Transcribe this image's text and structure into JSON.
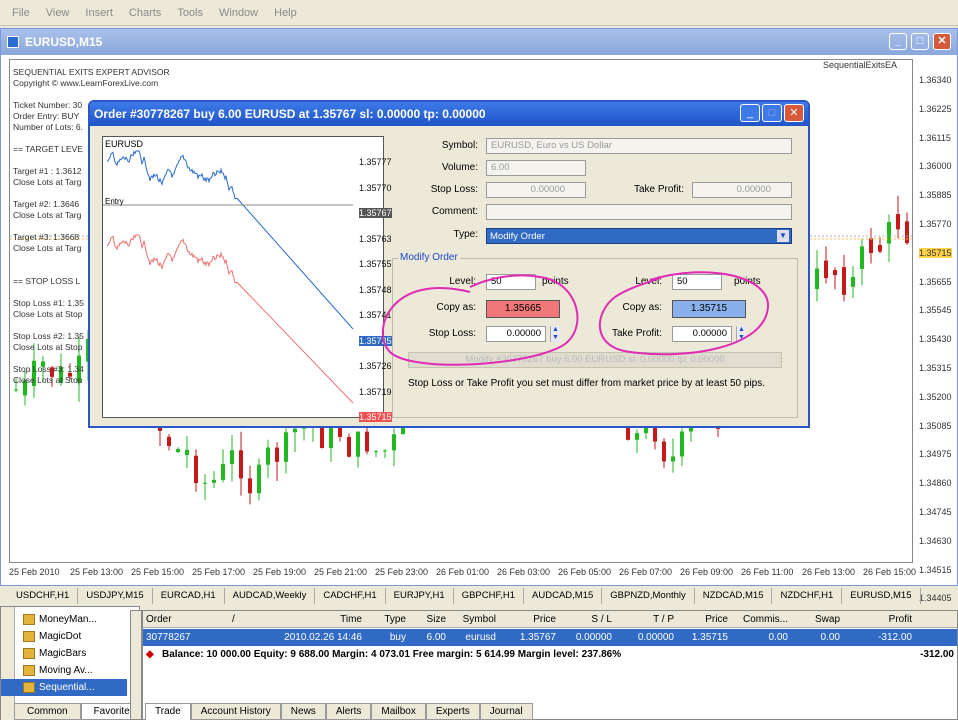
{
  "menu": [
    "File",
    "View",
    "Insert",
    "Charts",
    "Tools",
    "Window",
    "Help"
  ],
  "chart_window": {
    "title": "EURUSD,M15",
    "ea_label": "SequentialExitsEA",
    "y_ticks": [
      "1.36340",
      "1.36225",
      "1.36115",
      "1.36000",
      "1.35885",
      "1.35770",
      "1.35715",
      "1.35655",
      "1.35545",
      "1.35430",
      "1.35315",
      "1.35200",
      "1.35085",
      "1.34975",
      "1.34860",
      "1.34745",
      "1.34630",
      "1.34515",
      "1.34405"
    ],
    "x_ticks": [
      "25 Feb 2010",
      "25 Feb 13:00",
      "25 Feb 15:00",
      "25 Feb 17:00",
      "25 Feb 19:00",
      "25 Feb 21:00",
      "25 Feb 23:00",
      "26 Feb 01:00",
      "26 Feb 03:00",
      "26 Feb 05:00",
      "26 Feb 07:00",
      "26 Feb 09:00",
      "26 Feb 11:00",
      "26 Feb 13:00",
      "26 Feb 15:00"
    ],
    "info_lines": [
      "SEQUENTIAL EXITS EXPERT ADVISOR",
      "Copyright © www.LearnForexLive.com",
      "",
      "Ticket Number: 30",
      "Order Entry: BUY",
      "Number of Lots: 6.",
      "",
      "== TARGET LEVE",
      "",
      "Target #1 : 1.3612",
      "Close Lots at Targ",
      "",
      "Target #2: 1.3646",
      "Close Lots at Targ",
      "",
      "Target #3: 1.3668",
      "Close Lots at Targ",
      "",
      "",
      "== STOP LOSS L",
      "",
      "Stop Loss #1: 1.35",
      "Close Lots at Stop",
      "",
      "Stop Loss #2: 1.35",
      "Close Lots at Stop",
      "",
      "Stop Loss #3: 1.34",
      "Close Lots at Stop"
    ]
  },
  "symbol_tabs": [
    "USDCHF,H1",
    "USDJPY,M15",
    "EURCAD,H1",
    "AUDCAD,Weekly",
    "CADCHF,H1",
    "EURJPY,H1",
    "GBPCHF,H1",
    "AUDCAD,M15",
    "GBPNZD,Monthly",
    "NZDCAD,M15",
    "NZDCHF,H1",
    "EURUSD,M15"
  ],
  "navigator": {
    "items": [
      "MoneyMan...",
      "MagicDot",
      "MagicBars",
      "Moving Av...",
      "Sequential..."
    ],
    "tabs": [
      "Common",
      "Favorite"
    ],
    "side_label": "Navigator"
  },
  "terminal": {
    "side_label": "Terminal",
    "headers": [
      "Order",
      "/",
      "Time",
      "Type",
      "Size",
      "Symbol",
      "Price",
      "S / L",
      "T / P",
      "Price",
      "Commis...",
      "Swap",
      "Profit"
    ],
    "row": [
      "30778267",
      "2010.02.26 14:46",
      "buy",
      "6.00",
      "eurusd",
      "1.35767",
      "0.00000",
      "0.00000",
      "1.35715",
      "0.00",
      "0.00",
      "-312.00"
    ],
    "balance_line": "Balance: 10 000.00  Equity: 9 688.00  Margin: 4 073.01  Free margin: 5 614.99  Margin level: 237.86%",
    "balance_profit": "-312.00",
    "tabs": [
      "Trade",
      "Account History",
      "News",
      "Alerts",
      "Mailbox",
      "Experts",
      "Journal"
    ]
  },
  "dialog": {
    "title": "Order #30778267 buy 6.00 EURUSD at 1.35767 sl: 0.00000 tp: 0.00000",
    "mini_chart": {
      "symbol": "EURUSD",
      "entry_label": "Entry",
      "ticks": [
        "1.35777",
        "1.35770",
        "1.35767",
        "1.35763",
        "1.35755",
        "1.35748",
        "1.35741",
        "1.35735",
        "1.35726",
        "1.35719",
        "1.35715"
      ]
    },
    "symbol_label": "Symbol:",
    "symbol_value": "EURUSD, Euro vs US Dollar",
    "volume_label": "Volume:",
    "volume_value": "6.00",
    "stoploss_label": "Stop Loss:",
    "stoploss_value": "0.00000",
    "takeprofit_label": "Take Profit:",
    "takeprofit_value": "0.00000",
    "comment_label": "Comment:",
    "type_label": "Type:",
    "type_value": "Modify Order",
    "group_title": "Modify Order",
    "left": {
      "level_label": "Level:",
      "level_value": "50",
      "points": "points",
      "copy_label": "Copy as:",
      "copy_value": "1.35665",
      "sl_label": "Stop Loss:",
      "sl_value": "0.00000"
    },
    "right": {
      "level_label": "Level:",
      "level_value": "50",
      "points": "points",
      "copy_label": "Copy as:",
      "copy_value": "1.35715",
      "tp_label": "Take Profit:",
      "tp_value": "0.00000"
    },
    "modify_button": "Modify #30778267 buy 6.00 EURUSD sl: 0.00000 tp: 0.00000",
    "note": "Stop Loss or Take Profit you set must differ from market price by at least 50 pips."
  }
}
